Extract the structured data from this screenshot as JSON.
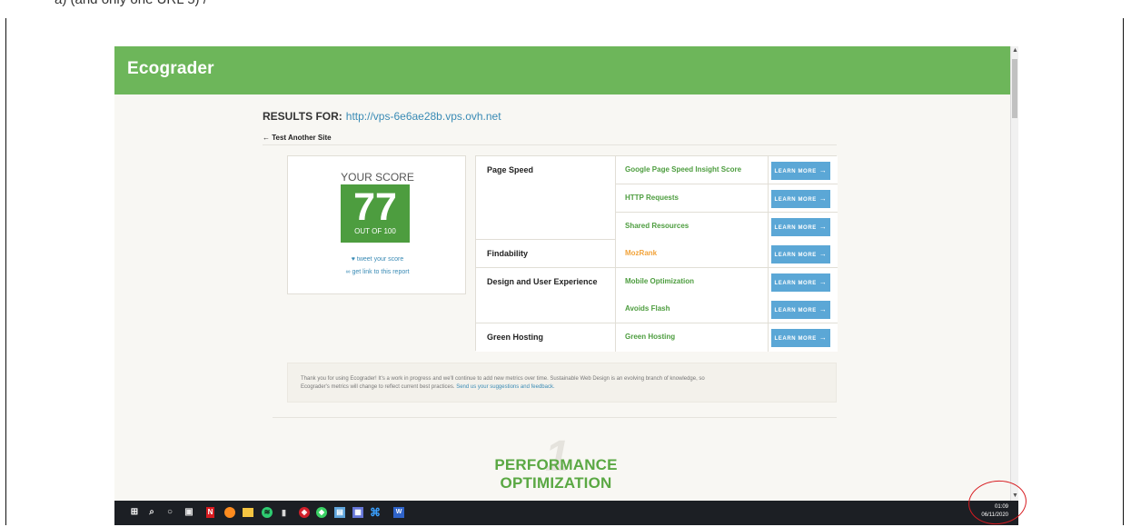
{
  "top_fragment": "a) (and only one URL 5) /",
  "site": {
    "logo": "Ecograder"
  },
  "results": {
    "label": "RESULTS FOR:",
    "url": "http://vps-6e6ae28b.vps.ovh.net",
    "test_another": "← Test Another Site"
  },
  "score": {
    "title": "YOUR SCORE",
    "value": "77",
    "out_of": "OUT OF 100",
    "tweet": "tweet your score",
    "tweet_icon": "twitter-icon",
    "report_link": "get link to this report",
    "report_icon": "link-icon"
  },
  "categories": [
    {
      "name": "Page Speed",
      "metrics": [
        {
          "name": "Google Page Speed Insight Score",
          "status": "green",
          "button": "LEARN MORE"
        },
        {
          "name": "HTTP Requests",
          "status": "green",
          "button": "LEARN MORE"
        },
        {
          "name": "Shared Resources",
          "status": "green",
          "button": "LEARN MORE"
        }
      ]
    },
    {
      "name": "Findability",
      "metrics": [
        {
          "name": "MozRank",
          "status": "orange",
          "button": "LEARN MORE"
        }
      ]
    },
    {
      "name": "Design and User Experience",
      "metrics": [
        {
          "name": "Mobile Optimization",
          "status": "green",
          "button": "LEARN MORE"
        },
        {
          "name": "Avoids Flash",
          "status": "green",
          "button": "LEARN MORE"
        }
      ]
    },
    {
      "name": "Green Hosting",
      "metrics": [
        {
          "name": "Green Hosting",
          "status": "green",
          "button": "LEARN MORE"
        }
      ]
    }
  ],
  "thanks": {
    "text_1": "Thank you for using Ecograder! It's a work in progress and we'll continue to add new metrics over time. Sustainable Web Design is an evolving branch of knowledge, so",
    "text_2": "Ecograder's metrics will change to reflect current best practices.",
    "link": "Send us your suggestions and feedback."
  },
  "section": {
    "number": "1",
    "title": "PERFORMANCE OPTIMIZATION"
  },
  "taskbar": {
    "time": "01:09",
    "date": "06/11/2020",
    "icons": [
      "windows-icon",
      "search-icon",
      "cortana-icon",
      "task-view-icon",
      "netflix-icon",
      "firefox-icon",
      "file-explorer-icon",
      "spotify-icon",
      "deezer-icon",
      "office-icon",
      "green-app-icon",
      "photos-icon",
      "teams-icon",
      "vscode-icon",
      "word-icon"
    ]
  },
  "colors": {
    "header": "#6db65a",
    "score": "#4d9d3f",
    "link": "#3a8bb5",
    "button": "#5ba7d6",
    "warning": "#f2a33a",
    "annotation": "#d71b20"
  }
}
